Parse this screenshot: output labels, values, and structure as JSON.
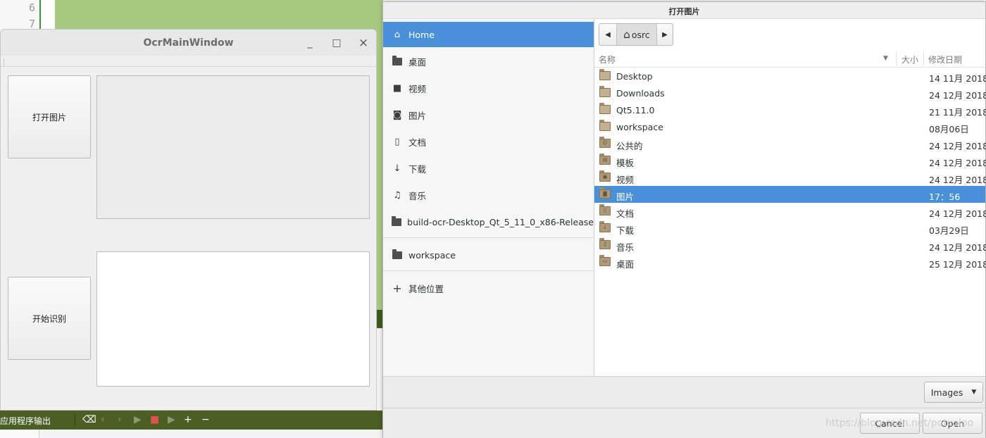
{
  "ide": {
    "line_numbers": [
      "6",
      "7"
    ],
    "bottombar_label": "应用程序输出",
    "toolbar_icons": [
      "broom-icon",
      "prev-icon",
      "next-icon",
      "run-icon",
      "stop-icon",
      "attach-run-icon",
      "plus-icon",
      "minus-icon"
    ]
  },
  "ocr_window": {
    "title": "OcrMainWindow",
    "open_image_button": "打开图片",
    "start_recognition_button": "开始识别",
    "controls": {
      "minimize": "_",
      "maximize": "□",
      "close": "×"
    }
  },
  "file_dialog": {
    "title": "打开图片",
    "sidebar": {
      "items": [
        {
          "label": "Home",
          "icon": "home-icon",
          "active": true
        },
        {
          "label": "桌面",
          "icon": "folder-icon"
        },
        {
          "label": "视频",
          "icon": "video-icon"
        },
        {
          "label": "图片",
          "icon": "camera-icon"
        },
        {
          "label": "文档",
          "icon": "document-icon"
        },
        {
          "label": "下载",
          "icon": "download-icon"
        },
        {
          "label": "音乐",
          "icon": "music-icon"
        },
        {
          "label": "build-ocr-Desktop_Qt_5_11_0_x86-Release",
          "icon": "folder-icon"
        },
        {
          "label": "workspace",
          "icon": "folder-icon"
        },
        {
          "label": "其他位置",
          "icon": "plus-icon"
        }
      ]
    },
    "pathbar": {
      "current": "osrc"
    },
    "columns": {
      "name": "名称",
      "size": "大小",
      "modified": "修改日期"
    },
    "files": [
      {
        "name": "Desktop",
        "date": "14 11月 2018"
      },
      {
        "name": "Downloads",
        "date": "24 12月 2018"
      },
      {
        "name": "Qt5.11.0",
        "date": "21 11月 2018"
      },
      {
        "name": "workspace",
        "date": "08月06日"
      },
      {
        "name": "公共的",
        "date": "24 12月 2018"
      },
      {
        "name": "模板",
        "date": "24 12月 2018"
      },
      {
        "name": "视频",
        "date": "24 12月 2018"
      },
      {
        "name": "图片",
        "date": "17：56",
        "selected": true
      },
      {
        "name": "文档",
        "date": "24 12月 2018"
      },
      {
        "name": "下载",
        "date": "03月29日"
      },
      {
        "name": "音乐",
        "date": "24 12月 2018"
      },
      {
        "name": "桌面",
        "date": "25 12月 2018"
      }
    ],
    "filter": "Images",
    "cancel_button": "Cancel",
    "open_button": "Open",
    "accent": "#4a90d9"
  },
  "watermark": "https://blog.csdn.net/potxoloo"
}
